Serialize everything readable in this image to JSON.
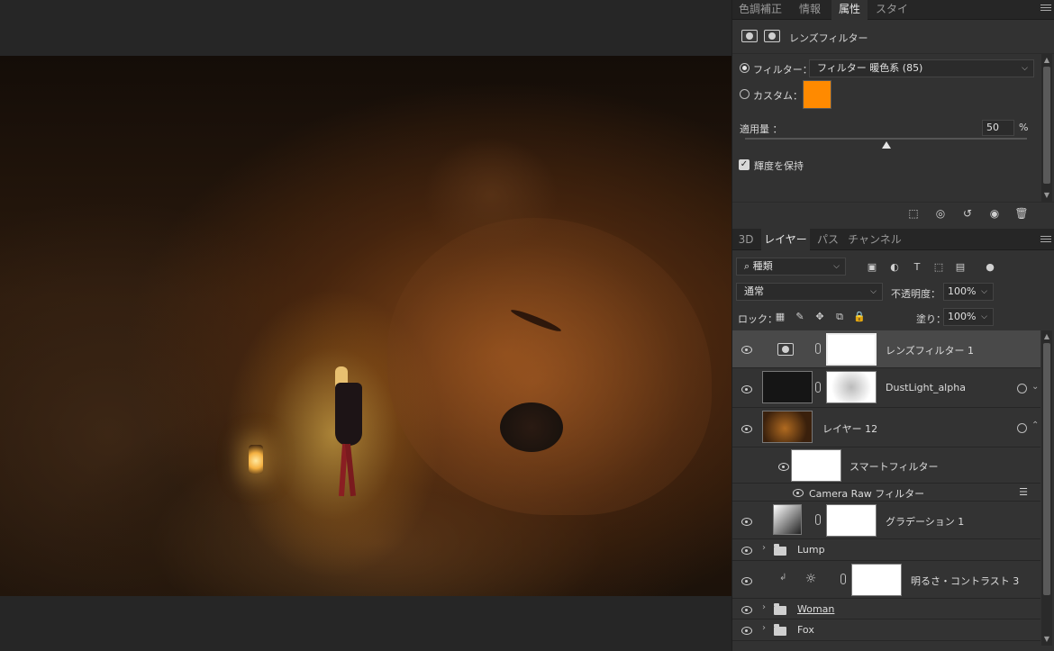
{
  "properties_tabs": [
    "色調補正",
    "情報",
    "属性",
    "スタイル"
  ],
  "properties": {
    "title": "レンズフィルター",
    "filter_label": "フィルター：",
    "filter_value": "フィルター 暖色系 (85)",
    "custom_label": "カスタム：",
    "custom_color": "#ff8a00",
    "density_label": "適用量 ：",
    "density_value": "50",
    "density_unit": "%",
    "density_level": 0.5,
    "preserve_label": "輝度を保持",
    "preserve_checked": true
  },
  "layers_tabs": [
    "3D",
    "レイヤー",
    "パス",
    "チャンネル"
  ],
  "layers_panel": {
    "filter_kind": "種類",
    "blend_mode": "通常",
    "opacity_label": "不透明度：",
    "opacity_value": "100%",
    "lock_label": "ロック：",
    "fill_label": "塗り：",
    "fill_value": "100%"
  },
  "layers": [
    {
      "name": "レンズフィルター 1",
      "type": "adjustment",
      "selected": true
    },
    {
      "name": "DustLight_alpha",
      "type": "smart-object"
    },
    {
      "name": "レイヤー 12",
      "type": "smart-object",
      "expanded": true
    },
    {
      "name": "スマートフィルター",
      "type": "smart-filter"
    },
    {
      "name": "Camera Raw フィルター",
      "type": "filter-item"
    },
    {
      "name": "グラデーション 1",
      "type": "gradient-fill"
    },
    {
      "name": "Lump",
      "type": "group"
    },
    {
      "name": "明るさ・コントラスト 3",
      "type": "adjustment-clipped"
    },
    {
      "name": "Woman",
      "type": "group"
    },
    {
      "name": "Fox",
      "type": "group"
    }
  ],
  "colors": {
    "panel_bg": "#323232",
    "selected_row": "#494949",
    "swatch": "#ff8a00"
  },
  "icons": [
    "lens-filter-icon",
    "mask-icon",
    "eye-icon",
    "chain-link-icon",
    "folder-icon",
    "sun-icon",
    "trash-icon",
    "reset-icon",
    "visibility-icon",
    "clip-icon"
  ]
}
